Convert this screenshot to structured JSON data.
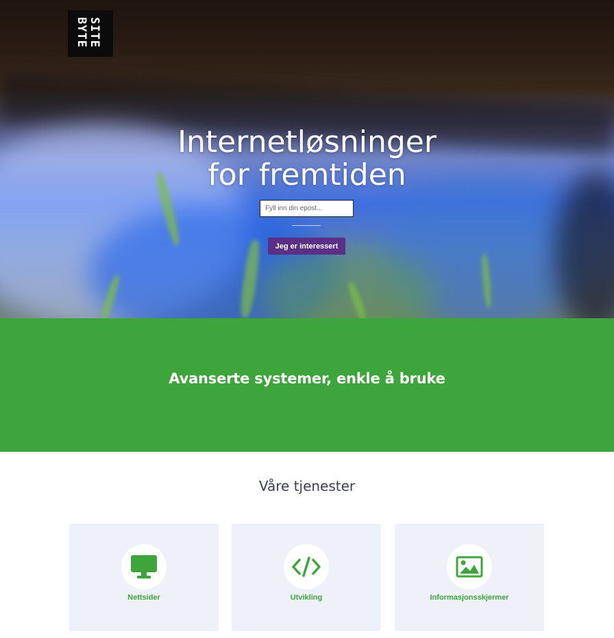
{
  "colors": {
    "accent_green": "#3da53b",
    "button_purple": "#5b2f86",
    "card_background": "#eef1f8",
    "heading_text": "#3a3f55"
  },
  "logo": {
    "line1": "SITE",
    "line2": "BYTE"
  },
  "hero": {
    "title_line1": "Internetløsninger",
    "title_line2": "for fremtiden",
    "email_placeholder": "Fyll inn din epost...",
    "button_label": "Jeg er interessert"
  },
  "tagline": "Avanserte systemer, enkle å bruke",
  "services": {
    "heading": "Våre tjenester",
    "items": [
      {
        "label": "Nettsider",
        "icon": "monitor-icon"
      },
      {
        "label": "Utvikling",
        "icon": "code-icon"
      },
      {
        "label": "Informasjonsskjermer",
        "icon": "image-icon"
      }
    ]
  }
}
